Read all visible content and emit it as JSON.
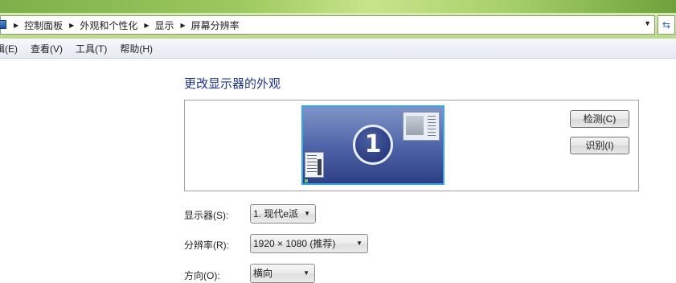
{
  "address_bar": {
    "breadcrumbs": [
      "控制面板",
      "外观和个性化",
      "显示",
      "屏幕分辨率"
    ]
  },
  "menu": [
    "辑(E)",
    "查看(V)",
    "工具(T)",
    "帮助(H)"
  ],
  "main": {
    "heading": "更改显示器的外观",
    "monitor_number": "1",
    "detect_button": "检测(C)",
    "identify_button": "识别(I)",
    "display_label": "显示器(S):",
    "display_value": "1. 现代e派",
    "resolution_label": "分辨率(R):",
    "resolution_value": "1920 × 1080 (推荐)",
    "orientation_label": "方向(O):",
    "orientation_value": "横向"
  },
  "colors": {
    "heading": "#1e3287",
    "monitor_border": "#39a8e8",
    "title_green": "#9cc85e"
  },
  "icons": [
    "computer-icon",
    "refresh-icon",
    "dropdown-arrow-icon"
  ]
}
